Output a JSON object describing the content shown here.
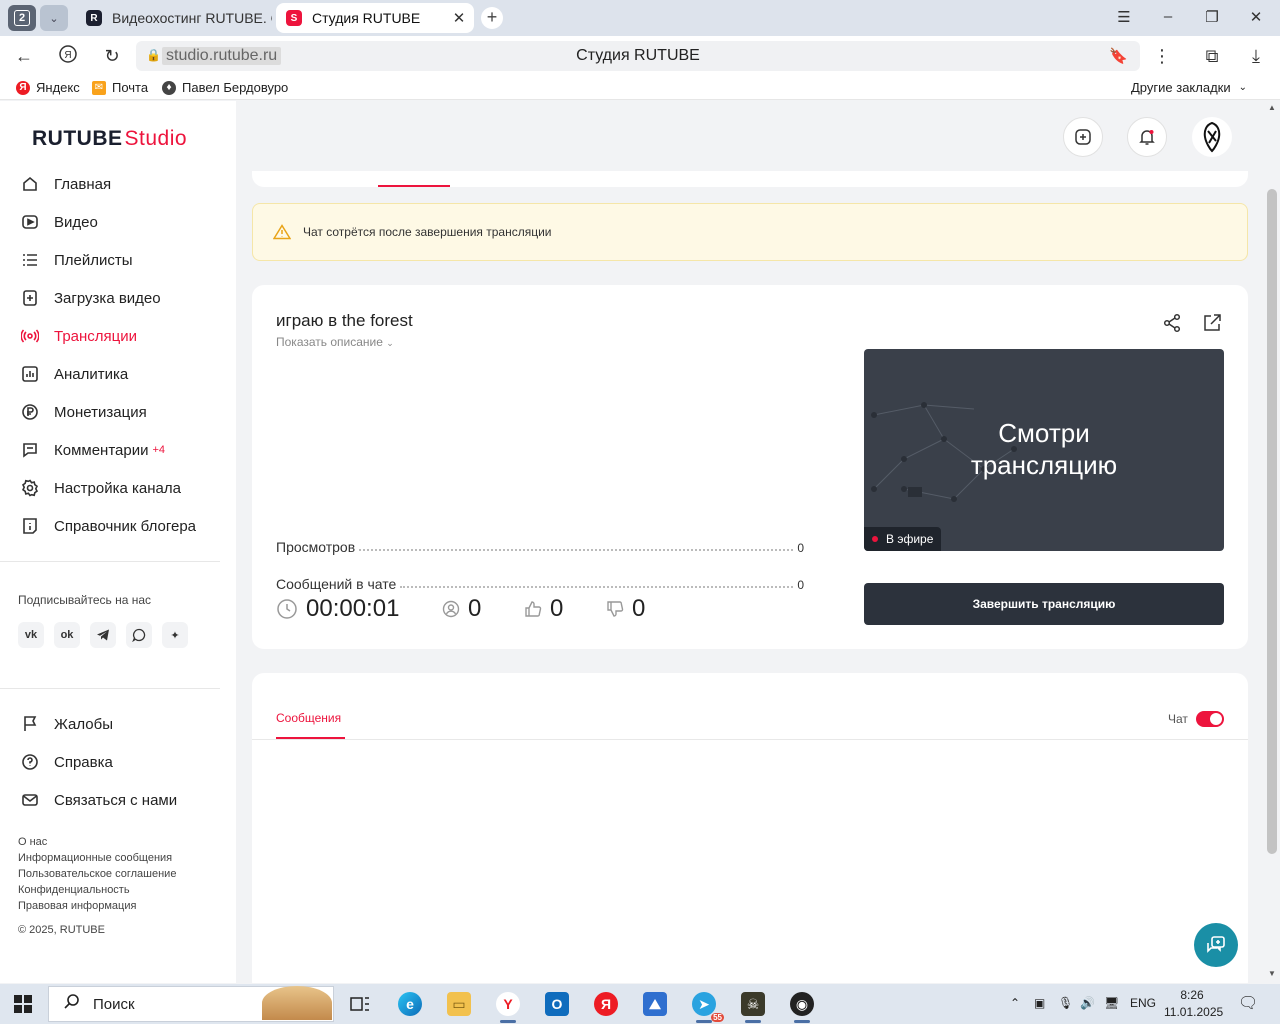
{
  "browser": {
    "tab_count": "2",
    "tabs": [
      {
        "title": "Видеохостинг RUTUBE. С",
        "active": false
      },
      {
        "title": "Студия RUTUBE",
        "active": true
      }
    ],
    "url_host": "studio.rutube.ru",
    "page_title": "Студия RUTUBE",
    "bookmarks": [
      "Яндекс",
      "Почта",
      "Павел Бердовуро"
    ],
    "other_bookmarks": "Другие закладки"
  },
  "logo": {
    "main": "RUTUBE",
    "studio": "Studio"
  },
  "sidebar": {
    "items": [
      {
        "label": "Главная",
        "icon": "home-icon"
      },
      {
        "label": "Видео",
        "icon": "video-icon"
      },
      {
        "label": "Плейлисты",
        "icon": "playlist-icon"
      },
      {
        "label": "Загрузка видео",
        "icon": "upload-icon"
      },
      {
        "label": "Трансляции",
        "icon": "broadcast-icon",
        "active": true
      },
      {
        "label": "Аналитика",
        "icon": "analytics-icon"
      },
      {
        "label": "Монетизация",
        "icon": "ruble-icon"
      },
      {
        "label": "Комментарии",
        "icon": "comment-icon",
        "badge": "+4"
      },
      {
        "label": "Настройка канала",
        "icon": "gear-icon"
      },
      {
        "label": "Справочник блогера",
        "icon": "info-icon"
      }
    ],
    "follow_title": "Подписывайтесь на нас",
    "socials": [
      "vk-icon",
      "ok-icon",
      "telegram-icon",
      "viber-icon",
      "dzen-icon"
    ],
    "secondary": [
      {
        "label": "Жалобы",
        "icon": "flag-icon"
      },
      {
        "label": "Справка",
        "icon": "help-icon"
      },
      {
        "label": "Связаться с нами",
        "icon": "mail-icon"
      }
    ],
    "footer_links": [
      "О нас",
      "Информационные сообщения",
      "Пользовательское соглашение",
      "Конфиденциальность",
      "Правовая информация"
    ],
    "copyright": "© 2025, RUTUBE"
  },
  "warning": {
    "text": "Чат сотрётся после завершения трансляции"
  },
  "stream": {
    "title": "играю в the forest",
    "show_description": "Показать описание",
    "stats": [
      {
        "label": "Просмотров",
        "value": "0"
      },
      {
        "label": "Сообщений в чате",
        "value": "0"
      }
    ],
    "duration": "00:00:01",
    "viewers": "0",
    "likes": "0",
    "dislikes": "0",
    "preview_text_1": "Смотри",
    "preview_text_2": "трансляцию",
    "live_label": "В эфире",
    "end_button": "Завершить трансляцию"
  },
  "chat": {
    "tab_label": "Сообщения",
    "toggle_label": "Чат",
    "toggle_on": true
  },
  "taskbar": {
    "search_label": "Поиск",
    "language": "ENG",
    "time": "8:26",
    "date": "11.01.2025",
    "telegram_badge": "55"
  },
  "colors": {
    "accent": "#ed143d",
    "dark_button": "#2c323c",
    "warning_bg": "#fef9e5"
  }
}
